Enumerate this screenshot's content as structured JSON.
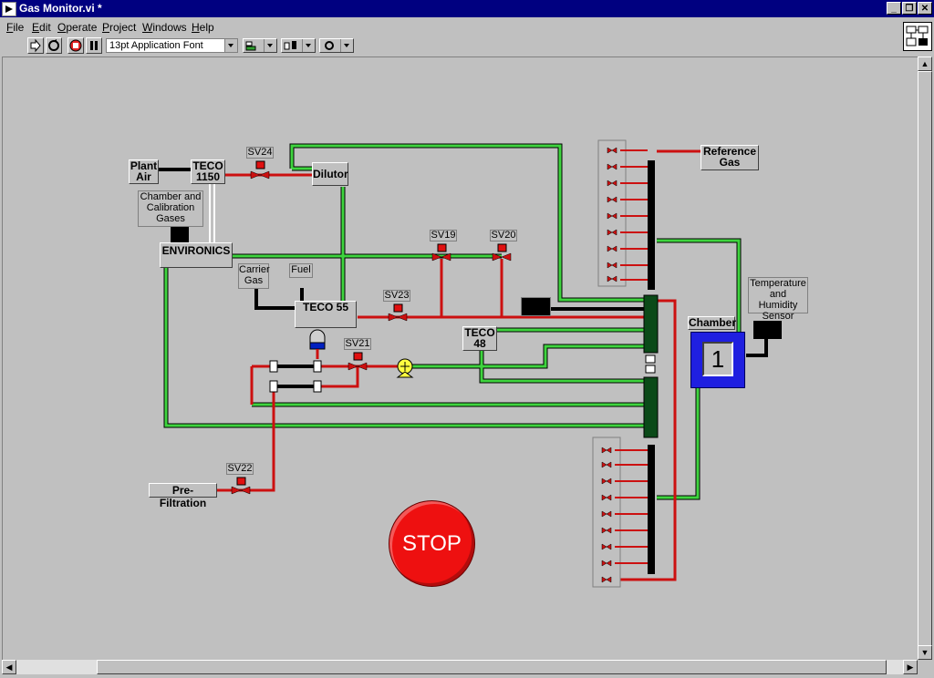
{
  "window": {
    "title": "Gas Monitor.vi *"
  },
  "menu": [
    {
      "hot": "F",
      "rest": "ile"
    },
    {
      "hot": "E",
      "rest": "dit"
    },
    {
      "hot": "O",
      "rest": "perate"
    },
    {
      "hot": "P",
      "rest": "roject"
    },
    {
      "hot": "W",
      "rest": "indows"
    },
    {
      "hot": "H",
      "rest": "elp"
    }
  ],
  "toolbar": {
    "font": "13pt Application Font"
  },
  "components": {
    "plant_air": "Plant Air",
    "teco1150": "TECO 1150",
    "sv24": "SV24",
    "dilutor": "Dilutor",
    "chamber_cal": "Chamber and Calibration Gases",
    "environics": "ENVIRONICS",
    "carrier": "Carrier Gas",
    "fuel": "Fuel",
    "teco55": "TECO 55",
    "sv19": "SV19",
    "sv20": "SV20",
    "sv23": "SV23",
    "sv21": "SV21",
    "teco48": "TECO 48",
    "sv22": "SV22",
    "prefilt": "Pre-Filtration",
    "reference": "Reference Gas",
    "temp_hum": "Temperature and Humidity Sensor",
    "chamber": "Chamber",
    "chamber_num": "1",
    "stop": "STOP"
  },
  "colors": {
    "pipe_red": "#cc1010",
    "pipe_green": "#30d030",
    "chamber_blue": "#1f1fe0"
  }
}
